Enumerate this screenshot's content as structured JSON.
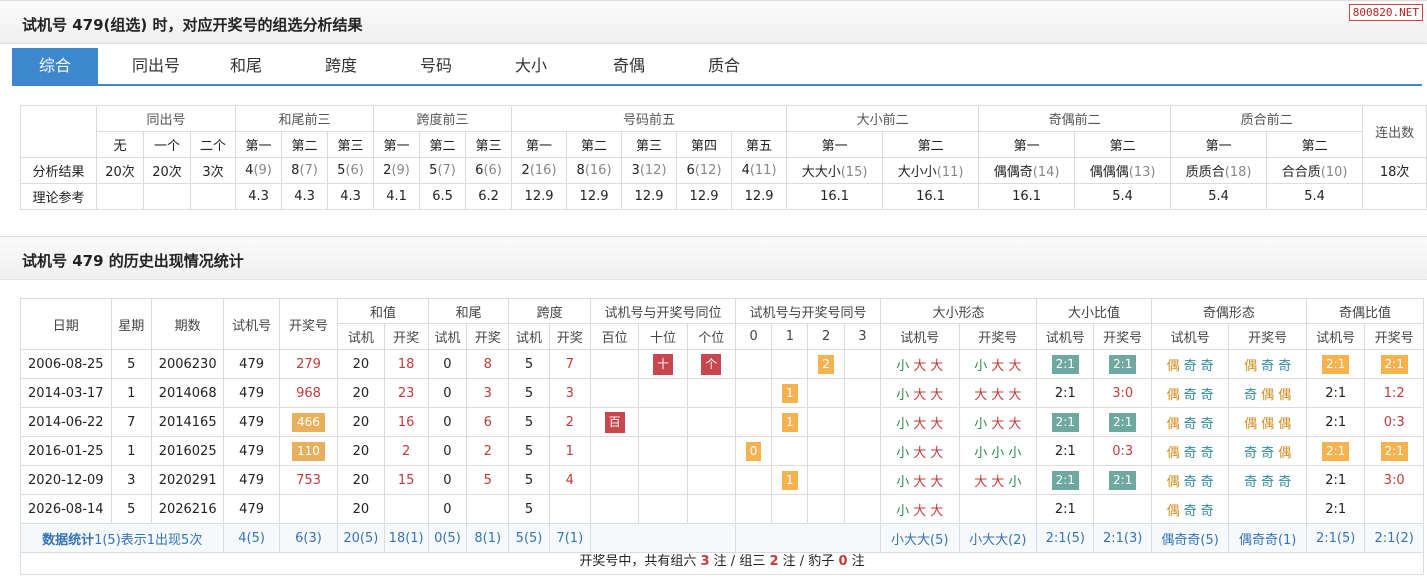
{
  "section1_title": "试机号 479(组选) 时，对应开奖号的组选分析结果",
  "watermark": "800820.NET",
  "tabs": [
    "综合",
    "同出号",
    "和尾",
    "跨度",
    "号码",
    "大小",
    "奇偶",
    "质合"
  ],
  "analysis": {
    "group_headers": [
      "同出号",
      "和尾前三",
      "跨度前三",
      "号码前五",
      "大小前二",
      "奇偶前二",
      "质合前二",
      "连出数"
    ],
    "sub_headers": [
      "无",
      "一个",
      "二个",
      "第一",
      "第二",
      "第三",
      "第一",
      "第二",
      "第三",
      "第一",
      "第二",
      "第三",
      "第四",
      "第五",
      "第一",
      "第二",
      "第一",
      "第二",
      "第一",
      "第二"
    ],
    "row_result_label": "分析结果",
    "row_ref_label": "理论参考",
    "results": [
      {
        "v": "20次",
        "n": ""
      },
      {
        "v": "20次",
        "n": ""
      },
      {
        "v": "3次",
        "n": ""
      },
      {
        "v": "4",
        "n": "(9)"
      },
      {
        "v": "8",
        "n": "(7)"
      },
      {
        "v": "5",
        "n": "(6)"
      },
      {
        "v": "2",
        "n": "(9)"
      },
      {
        "v": "5",
        "n": "(7)"
      },
      {
        "v": "6",
        "n": "(6)"
      },
      {
        "v": "2",
        "n": "(16)"
      },
      {
        "v": "8",
        "n": "(16)"
      },
      {
        "v": "3",
        "n": "(12)"
      },
      {
        "v": "6",
        "n": "(12)"
      },
      {
        "v": "4",
        "n": "(11)"
      },
      {
        "v": "大大小",
        "n": "(15)"
      },
      {
        "v": "大小小",
        "n": "(11)"
      },
      {
        "v": "偶偶奇",
        "n": "(14)"
      },
      {
        "v": "偶偶偶",
        "n": "(13)"
      },
      {
        "v": "质质合",
        "n": "(18)"
      },
      {
        "v": "合合质",
        "n": "(10)"
      },
      {
        "v": "18次",
        "n": ""
      }
    ],
    "refs": [
      "",
      "",
      "",
      "4.3",
      "4.3",
      "4.3",
      "4.1",
      "6.5",
      "6.2",
      "12.9",
      "12.9",
      "12.9",
      "12.9",
      "12.9",
      "16.1",
      "16.1",
      "16.1",
      "5.4",
      "5.4",
      "5.4",
      ""
    ]
  },
  "section2_title": "试机号 479 的历史出现情况统计",
  "history": {
    "headers_top": [
      "日期",
      "星期",
      "期数",
      "试机号",
      "开奖号",
      "和值",
      "和尾",
      "跨度",
      "试机号与开奖号同位",
      "试机号与开奖号同号",
      "大小形态",
      "大小比值",
      "奇偶形态",
      "奇偶比值"
    ],
    "headers_sub": [
      "试机",
      "开奖",
      "试机",
      "开奖",
      "试机",
      "开奖",
      "百位",
      "十位",
      "个位",
      "0",
      "1",
      "2",
      "3",
      "试机号",
      "开奖号",
      "试机号",
      "开奖号",
      "试机号",
      "开奖号",
      "试机号",
      "开奖号"
    ],
    "rows": [
      {
        "date": "2006-08-25",
        "week": "5",
        "issue": "2006230",
        "test": "479",
        "draw": "279",
        "draw_box": "",
        "sum_t": "20",
        "sum_d": "18",
        "tail_t": "0",
        "tail_d": "8",
        "span_t": "5",
        "span_d": "7",
        "pos": [
          "",
          "十",
          "个"
        ],
        "same": [
          "",
          "",
          "2",
          ""
        ],
        "size_t": [
          "小",
          "大",
          "大"
        ],
        "size_d": [
          "小",
          "大",
          "大"
        ],
        "sr_t": "2:1",
        "sr_t_box": "bt",
        "sr_d": "2:1",
        "sr_d_box": "bt",
        "oe_t": [
          "偶",
          "奇",
          "奇"
        ],
        "oe_d": [
          "偶",
          "奇",
          "奇"
        ],
        "or_t": "2:1",
        "or_t_box": "bo",
        "or_d": "2:1",
        "or_d_box": "bo"
      },
      {
        "date": "2014-03-17",
        "week": "1",
        "issue": "2014068",
        "test": "479",
        "draw": "968",
        "draw_box": "",
        "sum_t": "20",
        "sum_d": "23",
        "tail_t": "0",
        "tail_d": "3",
        "span_t": "5",
        "span_d": "3",
        "pos": [
          "",
          "",
          ""
        ],
        "same": [
          "",
          "1",
          "",
          ""
        ],
        "size_t": [
          "小",
          "大",
          "大"
        ],
        "size_d": [
          "大",
          "大",
          "大"
        ],
        "sr_t": "2:1",
        "sr_t_box": "",
        "sr_d": "3:0",
        "sr_d_box": "red",
        "oe_t": [
          "偶",
          "奇",
          "奇"
        ],
        "oe_d": [
          "奇",
          "偶",
          "偶"
        ],
        "or_t": "2:1",
        "or_t_box": "",
        "or_d": "1:2",
        "or_d_box": "red"
      },
      {
        "date": "2014-06-22",
        "week": "7",
        "issue": "2014165",
        "test": "479",
        "draw": "466",
        "draw_box": "pw",
        "sum_t": "20",
        "sum_d": "16",
        "tail_t": "0",
        "tail_d": "6",
        "span_t": "5",
        "span_d": "2",
        "pos": [
          "百",
          "",
          ""
        ],
        "same": [
          "",
          "1",
          "",
          ""
        ],
        "size_t": [
          "小",
          "大",
          "大"
        ],
        "size_d": [
          "小",
          "大",
          "大"
        ],
        "sr_t": "2:1",
        "sr_t_box": "bt",
        "sr_d": "2:1",
        "sr_d_box": "bt",
        "oe_t": [
          "偶",
          "奇",
          "奇"
        ],
        "oe_d": [
          "偶",
          "偶",
          "偶"
        ],
        "or_t": "2:1",
        "or_t_box": "",
        "or_d": "0:3",
        "or_d_box": "red"
      },
      {
        "date": "2016-01-25",
        "week": "1",
        "issue": "2016025",
        "test": "479",
        "draw": "110",
        "draw_box": "pw",
        "sum_t": "20",
        "sum_d": "2",
        "tail_t": "0",
        "tail_d": "2",
        "span_t": "5",
        "span_d": "1",
        "pos": [
          "",
          "",
          ""
        ],
        "same": [
          "0",
          "",
          "",
          ""
        ],
        "size_t": [
          "小",
          "大",
          "大"
        ],
        "size_d": [
          "小",
          "小",
          "小"
        ],
        "sr_t": "2:1",
        "sr_t_box": "",
        "sr_d": "0:3",
        "sr_d_box": "red",
        "oe_t": [
          "偶",
          "奇",
          "奇"
        ],
        "oe_d": [
          "奇",
          "奇",
          "偶"
        ],
        "or_t": "2:1",
        "or_t_box": "bo",
        "or_d": "2:1",
        "or_d_box": "bo"
      },
      {
        "date": "2020-12-09",
        "week": "3",
        "issue": "2020291",
        "test": "479",
        "draw": "753",
        "draw_box": "",
        "sum_t": "20",
        "sum_d": "15",
        "tail_t": "0",
        "tail_d": "5",
        "span_t": "5",
        "span_d": "4",
        "pos": [
          "",
          "",
          ""
        ],
        "same": [
          "",
          "1",
          "",
          ""
        ],
        "size_t": [
          "小",
          "大",
          "大"
        ],
        "size_d": [
          "大",
          "大",
          "小"
        ],
        "sr_t": "2:1",
        "sr_t_box": "bt",
        "sr_d": "2:1",
        "sr_d_box": "bt",
        "oe_t": [
          "偶",
          "奇",
          "奇"
        ],
        "oe_d": [
          "奇",
          "奇",
          "奇"
        ],
        "or_t": "2:1",
        "or_t_box": "",
        "or_d": "3:0",
        "or_d_box": "red"
      },
      {
        "date": "2026-08-14",
        "week": "5",
        "issue": "2026216",
        "test": "479",
        "draw": "",
        "draw_box": "",
        "sum_t": "20",
        "sum_d": "",
        "tail_t": "0",
        "tail_d": "",
        "span_t": "5",
        "span_d": "",
        "pos": [
          "",
          "",
          ""
        ],
        "same": [
          "",
          "",
          "",
          ""
        ],
        "size_t": [
          "小",
          "大",
          "大"
        ],
        "size_d": [
          "",
          "",
          ""
        ],
        "sr_t": "2:1",
        "sr_t_box": "",
        "sr_d": "",
        "sr_d_box": "",
        "oe_t": [
          "偶",
          "奇",
          "奇"
        ],
        "oe_d": [
          "",
          "",
          ""
        ],
        "or_t": "2:1",
        "or_t_box": "",
        "or_d": "",
        "or_d_box": ""
      }
    ],
    "stat_label": "数据统计",
    "stat_note": "1(5)表示1出现5次",
    "stats": [
      "4(5)",
      "6(3)",
      "20(5)",
      "18(1)",
      "0(5)",
      "8(1)",
      "5(5)",
      "7(1)",
      "小大大(5)",
      "小大大(2)",
      "2:1(5)",
      "2:1(3)",
      "偶奇奇(5)",
      "偶奇奇(1)",
      "2:1(5)",
      "2:1(2)"
    ],
    "footer": {
      "p1": "开奖号中，共有组六 ",
      "n1": "3",
      "p2": " 注 / 组三 ",
      "n2": "2",
      "p3": " 注 / 豹子 ",
      "n3": "0",
      "p4": " 注"
    }
  }
}
